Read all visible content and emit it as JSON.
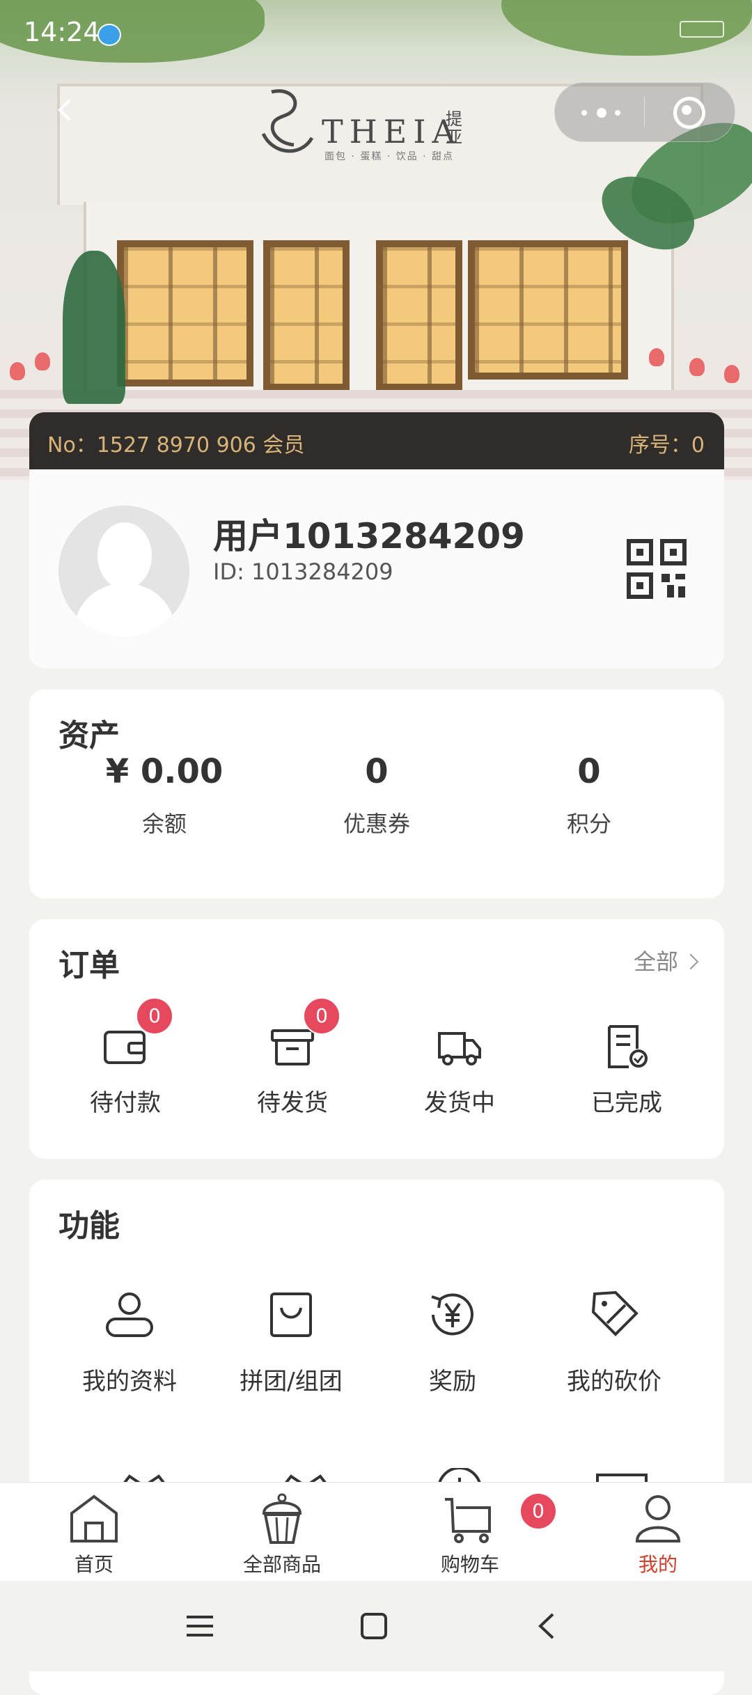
{
  "status_bar": {
    "time": "14:24"
  },
  "hero": {
    "brand_name": "THEIA",
    "brand_cn": "提亚",
    "brand_tagline": "面包 · 蛋糕 · 饮品 · 甜点"
  },
  "member": {
    "no_text": "No：1527 8970 906 会员",
    "seq_text": "序号：0"
  },
  "profile": {
    "name": "用户1013284209",
    "id_text": "ID: 1013284209"
  },
  "assets": {
    "title": "资产",
    "items": [
      {
        "value": "¥ 0.00",
        "label": "余额"
      },
      {
        "value": "0",
        "label": "优惠券"
      },
      {
        "value": "0",
        "label": "积分"
      }
    ]
  },
  "orders": {
    "title": "订单",
    "all_label": "全部",
    "items": [
      {
        "label": "待付款",
        "badge": "0",
        "icon": "wallet-icon"
      },
      {
        "label": "待发货",
        "badge": "0",
        "icon": "box-icon"
      },
      {
        "label": "发货中",
        "icon": "truck-icon"
      },
      {
        "label": "已完成",
        "icon": "document-check-icon"
      }
    ]
  },
  "functions": {
    "title": "功能",
    "items": [
      {
        "label": "我的资料",
        "icon": "profile-icon"
      },
      {
        "label": "拼团/组团",
        "icon": "shopping-bag-icon"
      },
      {
        "label": "奖励",
        "icon": "yen-coin-icon"
      },
      {
        "label": "我的砍价",
        "icon": "price-tag-icon"
      }
    ]
  },
  "tabbar": {
    "items": [
      {
        "label": "首页",
        "icon": "home-icon"
      },
      {
        "label": "全部商品",
        "icon": "cupcake-icon"
      },
      {
        "label": "购物车",
        "icon": "cart-icon"
      },
      {
        "label": "我的",
        "icon": "user-icon"
      }
    ],
    "cart_badge": "0",
    "active_color": "#d0412c"
  },
  "colors": {
    "badge": "#e6495d",
    "member_bar": "#2f2c2a",
    "member_text": "#d8b47a"
  }
}
